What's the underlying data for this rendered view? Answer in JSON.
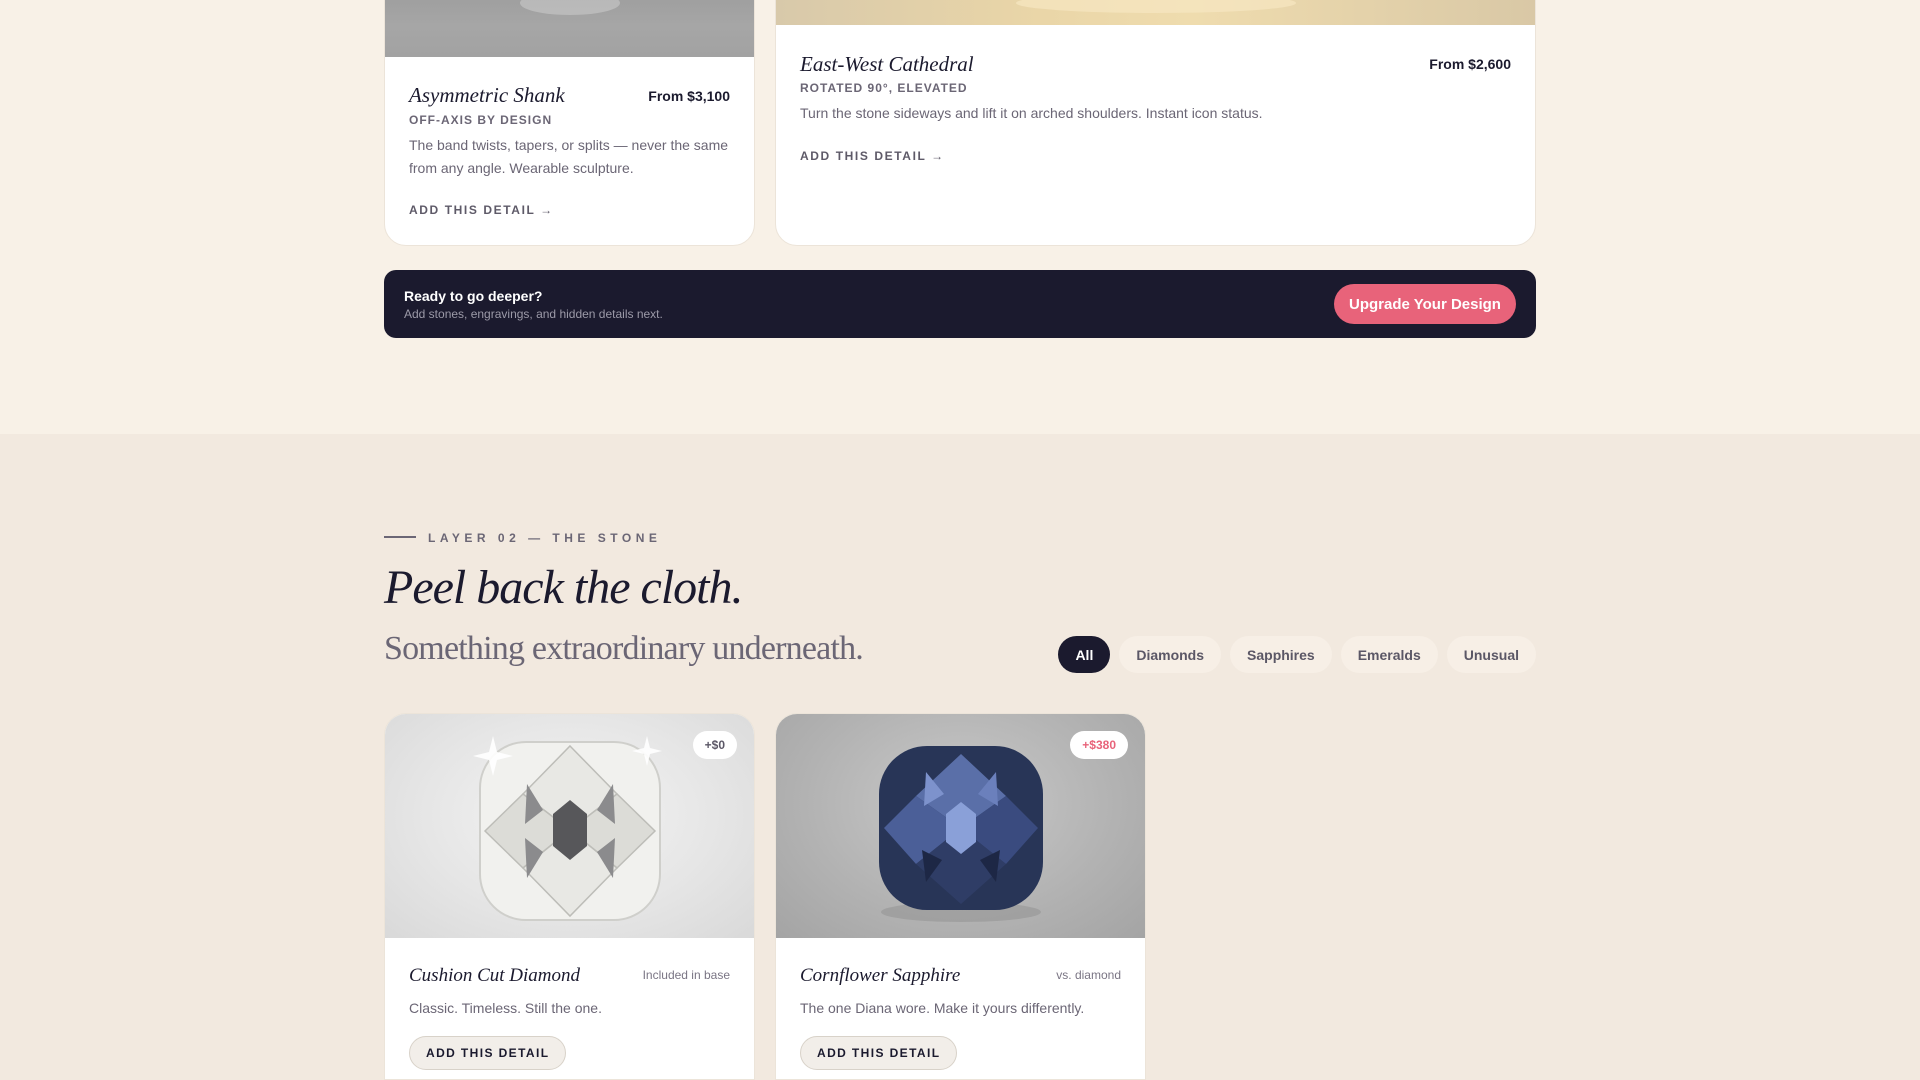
{
  "colors": {
    "accent": "#e8637a",
    "dark": "#1b1a2e",
    "cream": "#f8f1e7",
    "sand": "#f2e9df"
  },
  "detail_cards": [
    {
      "title": "Asymmetric Shank",
      "price": "From $3,100",
      "subtitle": "OFF-AXIS BY DESIGN",
      "description": "The band twists, tapers, or splits — never the same from any angle. Wearable sculpture.",
      "cta": "ADD THIS DETAIL →",
      "image": "gray-ring-photo"
    },
    {
      "title": "East-West Cathedral",
      "price": "From $2,600",
      "subtitle": "ROTATED 90°, ELEVATED",
      "description": "Turn the stone sideways and lift it on arched shoulders. Instant icon status.",
      "cta": "ADD THIS DETAIL →",
      "image": "gold-ring-photo"
    }
  ],
  "cta_bar": {
    "title": "Ready to go deeper?",
    "subtitle": "Add stones, engravings, and hidden details next.",
    "button": "Upgrade Your Design"
  },
  "section": {
    "eyebrow": "LAYER 02 — THE STONE",
    "headline": "Peel back the cloth.",
    "subhead": "Something extraordinary underneath."
  },
  "filters": {
    "items": [
      "All",
      "Diamonds",
      "Sapphires",
      "Emeralds",
      "Unusual"
    ],
    "active": "All"
  },
  "stones": [
    {
      "name": "Cushion Cut Diamond",
      "badge": "+$0",
      "badge_color": "#5b5766",
      "note": "Included in base",
      "description": "Classic. Timeless. Still the one.",
      "cta": "ADD THIS DETAIL",
      "image": "diamond-photo"
    },
    {
      "name": "Cornflower Sapphire",
      "badge": "+$380",
      "badge_color": "#e8637a",
      "note": "vs. diamond",
      "description": "The one Diana wore. Make it yours differently.",
      "cta": "ADD THIS DETAIL",
      "image": "sapphire-photo"
    }
  ]
}
